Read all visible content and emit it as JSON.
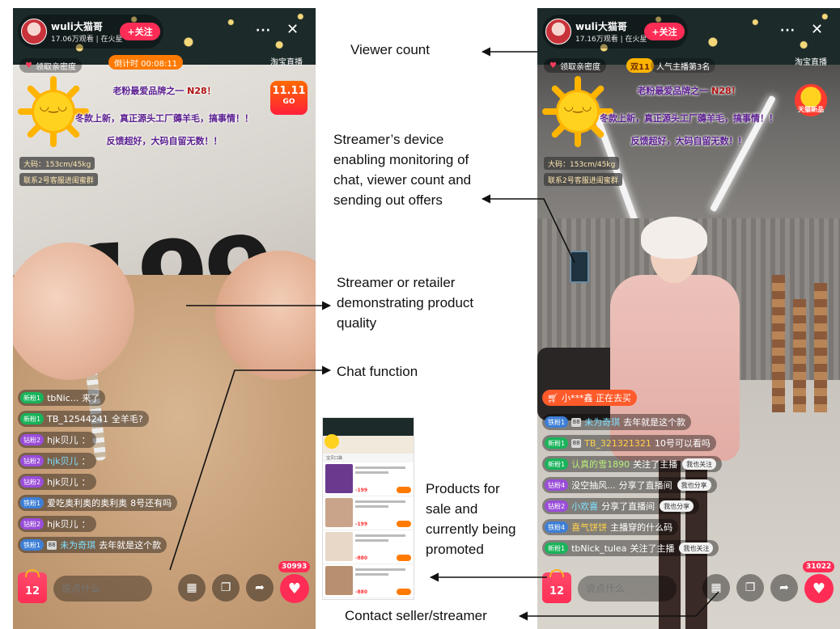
{
  "left_phone": {
    "streamer_name": "wuli大猫哥",
    "viewers": "17.06万观看 | 在火星",
    "follow_label": "+关注",
    "more_label": "···",
    "close_label": "✕",
    "intimacy_label": "领取亲密度",
    "countdown_label": "倒计时 00:08:11",
    "taobao_live": "淘宝直播",
    "promo_line1_a": "老粉最爱品牌之一",
    "promo_line1_b": "N28！",
    "promo_line2": "冬款上新，真正源头工厂薅羊毛，搞事情！！",
    "promo_line3": "反馈超好，大码自留无数！！",
    "badge_1111": "11.11",
    "badge_1111_sub": "GO",
    "model_info": "大码：153cm/45kg",
    "contact_tag": "联系2号客服进闺蜜群",
    "sweater_number": "199",
    "chat": [
      {
        "level": "新粉1",
        "user": "tbNic...",
        "text": "来了",
        "type": "new",
        "style": "plain"
      },
      {
        "level": "新粉1",
        "user": "TB_12544241",
        "text": "全羊毛?",
        "type": "new",
        "style": "plain"
      },
      {
        "level": "钻粉2",
        "user": "hjk贝儿",
        "text": "：",
        "type": "diamond",
        "style": "plain"
      },
      {
        "level": "钻粉2",
        "user": "hjk贝儿",
        "text": "：",
        "type": "diamond",
        "style": "cyan"
      },
      {
        "level": "钻粉2",
        "user": "hjk贝儿",
        "text": "：",
        "type": "diamond",
        "style": "plain"
      },
      {
        "level": "铁粉1",
        "user": "爱吃奥利奥的奥利奥",
        "text": "8号还有吗",
        "type": "iron",
        "style": "plain"
      },
      {
        "level": "钻粉2",
        "user": "hjk贝儿",
        "text": "：",
        "type": "diamond",
        "style": "plain"
      },
      {
        "level": "铁粉1",
        "user": "未为奇琪",
        "text": "去年就是这个款",
        "type": "iron",
        "style": "cyan"
      }
    ],
    "crown_label": "88",
    "cart_count": "12",
    "input_placeholder": "说点什么",
    "like_count": "30993"
  },
  "right_phone": {
    "streamer_name": "wuli大猫哥",
    "viewers": "17.16万观看 | 在火星",
    "follow_label": "+关注",
    "more_label": "···",
    "close_label": "✕",
    "intimacy_label": "领取亲密度",
    "double11_label": "双11",
    "rank_label": "人气主播第3名",
    "taobao_live": "淘宝直播",
    "promo_line1_a": "老粉最爱品牌之一",
    "promo_line1_b": "N28！",
    "promo_line2": "冬款上新，真正源头工厂薅羊毛，搞事情！！",
    "promo_line3": "反馈超好，大码自留无数！！",
    "badge_red_label": "天猫新品",
    "model_info": "大码：153cm/45kg",
    "contact_tag": "联系2号客服进闺蜜群",
    "buying_label": "小***鑫  正在去买",
    "chat": [
      {
        "level": "铁粉1",
        "user": "未为奇琪",
        "text": "去年就是这个款",
        "type": "iron",
        "style": "cyan",
        "crown": true,
        "action": ""
      },
      {
        "level": "新粉1",
        "user": "TB_321321321",
        "text": "10号可以看吗",
        "type": "new",
        "style": "gold",
        "crown": true,
        "action": ""
      },
      {
        "level": "新粉1",
        "user": "认真的雪1890",
        "text": "关注了主播",
        "type": "new",
        "style": "green",
        "crown": false,
        "action": "我也关注"
      },
      {
        "level": "钻粉4",
        "user": "没空抽风...",
        "text": "分享了直播间",
        "type": "diamond",
        "style": "plain",
        "crown": false,
        "action": "我也分享"
      },
      {
        "level": "钻粉2",
        "user": "小欢喜",
        "text": "分享了直播间",
        "type": "diamond",
        "style": "cyan",
        "crown": false,
        "action": "我也分享"
      },
      {
        "level": "铁粉4",
        "user": "喜气饼饼",
        "text": "主播穿的什么码",
        "type": "iron",
        "style": "gold",
        "crown": false,
        "action": ""
      },
      {
        "level": "新粉1",
        "user": "tbNick_tulea",
        "text": "关注了主播",
        "type": "new",
        "style": "plain",
        "crown": false,
        "action": "我也关注"
      }
    ],
    "cart_count": "12",
    "input_placeholder": "说点什么",
    "like_count": "31022"
  },
  "product_list": {
    "header": "宝贝口袋",
    "items": [
      {
        "price": "-199",
        "color": "#6b3a8f"
      },
      {
        "price": "-199",
        "color": "#c9a48a"
      },
      {
        "price": "-880",
        "color": "#e8d8c8"
      },
      {
        "price": "-880",
        "color": "#b89070"
      }
    ]
  },
  "annotations": {
    "viewer_count": "Viewer count",
    "streamer_device": [
      "Streamer’s device",
      "enabling monitoring of",
      "chat, viewer count and",
      "sending out offers"
    ],
    "product_quality": [
      "Streamer or retailer",
      "demonstrating product",
      "quality"
    ],
    "chat_function": "Chat function",
    "products_promoted": [
      "Products for",
      "sale and",
      "currently being",
      "promoted"
    ],
    "contact_seller": "Contact seller/streamer"
  }
}
